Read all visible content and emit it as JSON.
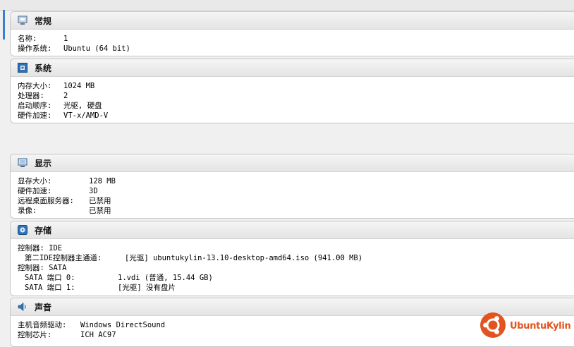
{
  "general": {
    "title": "常规",
    "rows": [
      {
        "label": "名称:",
        "value": "1"
      },
      {
        "label": "操作系统:",
        "value": "Ubuntu (64 bit)"
      }
    ]
  },
  "system": {
    "title": "系统",
    "rows": [
      {
        "label": "内存大小:",
        "value": "1024 MB"
      },
      {
        "label": "处理器:",
        "value": "2"
      },
      {
        "label": "启动顺序:",
        "value": "光驱, 硬盘"
      },
      {
        "label": "硬件加速:",
        "value": "VT-x/AMD-V"
      }
    ]
  },
  "display": {
    "title": "显示",
    "rows": [
      {
        "label": "显存大小:",
        "value": "128 MB"
      },
      {
        "label": "硬件加速:",
        "value": "3D"
      },
      {
        "label": "远程桌面服务器:",
        "value": "已禁用"
      },
      {
        "label": "录像:",
        "value": "已禁用"
      }
    ]
  },
  "storage": {
    "title": "存储",
    "controller_ide": "控制器: IDE",
    "ide_channel_label": "第二IDE控制器主通道:",
    "ide_channel_value": "[光驱] ubuntukylin-13.10-desktop-amd64.iso (941.00 MB)",
    "controller_sata": "控制器: SATA",
    "sata_ports": [
      {
        "label": "SATA 端口 0:",
        "value": "1.vdi (普通, 15.44 GB)"
      },
      {
        "label": "SATA 端口 1:",
        "value": "[光驱] 没有盘片"
      }
    ]
  },
  "audio": {
    "title": "声音",
    "rows": [
      {
        "label": "主机音频驱动:",
        "value": "Windows DirectSound"
      },
      {
        "label": "控制芯片:",
        "value": "ICH AC97"
      }
    ]
  },
  "watermark": {
    "text": "UbuntuKylin",
    "color": "#e2531f"
  },
  "icons": {
    "general": "monitor-icon",
    "system": "chip-icon",
    "display": "display-icon",
    "storage": "storage-icon",
    "audio": "speaker-icon"
  }
}
